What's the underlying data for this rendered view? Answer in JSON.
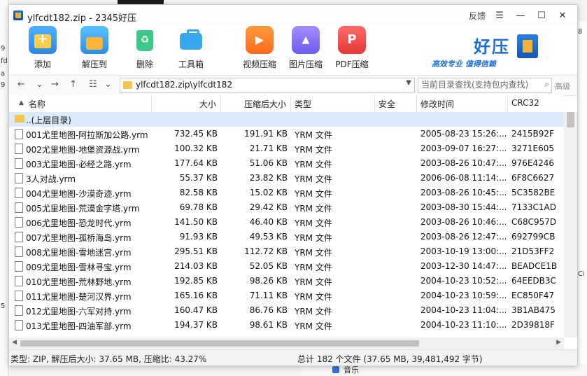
{
  "window": {
    "title": "ylfcdt182.zip - 2345好压",
    "feedback": "反馈",
    "minimize": "—",
    "restore": "☐",
    "close": "✕",
    "menu": "☰"
  },
  "toolbar": {
    "items": [
      {
        "label": "添加",
        "icon": "add-icon"
      },
      {
        "label": "解压到",
        "icon": "extract-icon"
      },
      {
        "label": "删除",
        "icon": "delete-icon"
      },
      {
        "label": "工具箱",
        "icon": "toolbox-icon"
      },
      {
        "label": "视频压缩",
        "icon": "video-compress-icon"
      },
      {
        "label": "图片压缩",
        "icon": "image-compress-icon"
      },
      {
        "label": "PDF压缩",
        "icon": "pdf-compress-icon"
      }
    ],
    "brand_name": "好压",
    "brand_slogan": "高效专业  值得信赖"
  },
  "addressbar": {
    "back": "←",
    "forward": "⌄",
    "up": "↑",
    "view": "☷",
    "view_dd": "⌄",
    "path": "ylfcdt182.zip\\ylfcdt182",
    "dropdown": "▼",
    "search_placeholder": "当前目录查找(支持包内查找)",
    "search_icon": "⌕",
    "advanced": "高级"
  },
  "table": {
    "columns": [
      "名称",
      "大小",
      "压缩后大小",
      "类型",
      "安全",
      "修改时间",
      "CRC32"
    ],
    "sort_indicator": "▲",
    "parent_label": "..(上层目录)",
    "rows": [
      {
        "name": "001尤里地图-阿拉斯加公路.yrm",
        "size": "732.45 KB",
        "packed": "191.91 KB",
        "type": "YRM 文件",
        "safe": "",
        "mtime": "2005-08-23 15:26:...",
        "crc": "2415B92F"
      },
      {
        "name": "002尤里地图-地堡资源战.yrm",
        "size": "100.32 KB",
        "packed": "21.71 KB",
        "type": "YRM 文件",
        "safe": "",
        "mtime": "2003-09-07 16:27:...",
        "crc": "3271E605"
      },
      {
        "name": "003尤里地图-必经之路.yrm",
        "size": "177.64 KB",
        "packed": "51.06 KB",
        "type": "YRM 文件",
        "safe": "",
        "mtime": "2003-08-26 10:47:...",
        "crc": "976E4246"
      },
      {
        "name": "3人对战.yrm",
        "size": "55.37 KB",
        "packed": "23.82 KB",
        "type": "YRM 文件",
        "safe": "",
        "mtime": "2006-06-08 11:14:...",
        "crc": "6F8C6627"
      },
      {
        "name": "004尤里地图-沙漠奇迹.yrm",
        "size": "82.58 KB",
        "packed": "15.02 KB",
        "type": "YRM 文件",
        "safe": "",
        "mtime": "2003-08-26 10:45:...",
        "crc": "5C3582BE"
      },
      {
        "name": "005尤里地图-荒漠金字塔.yrm",
        "size": "69.78 KB",
        "packed": "29.42 KB",
        "type": "YRM 文件",
        "safe": "",
        "mtime": "2003-08-30 15:44:...",
        "crc": "7133C1AD"
      },
      {
        "name": "006尤里地图-恐龙时代.yrm",
        "size": "141.50 KB",
        "packed": "46.40 KB",
        "type": "YRM 文件",
        "safe": "",
        "mtime": "2003-08-26 10:46:...",
        "crc": "C68C957D"
      },
      {
        "name": "007尤里地图-孤桥海岛.yrm",
        "size": "91.93 KB",
        "packed": "49.53 KB",
        "type": "YRM 文件",
        "safe": "",
        "mtime": "2003-08-26 12:47:...",
        "crc": "692799CB"
      },
      {
        "name": "008尤里地图-雪地迷宫.yrm",
        "size": "295.51 KB",
        "packed": "112.72 KB",
        "type": "YRM 文件",
        "safe": "",
        "mtime": "2003-10-19 13:00:...",
        "crc": "21D53FF2"
      },
      {
        "name": "009尤里地图-雪林寻宝.yrm",
        "size": "214.03 KB",
        "packed": "52.05 KB",
        "type": "YRM 文件",
        "safe": "",
        "mtime": "2003-12-30 14:47:...",
        "crc": "BEADCE1B"
      },
      {
        "name": "010尤里地图-荒林野地.yrm",
        "size": "192.85 KB",
        "packed": "98.26 KB",
        "type": "YRM 文件",
        "safe": "",
        "mtime": "2004-10-23 10:52:...",
        "crc": "64EEDB3C"
      },
      {
        "name": "011尤里地图-楚河汉界.yrm",
        "size": "165.16 KB",
        "packed": "71.11 KB",
        "type": "YRM 文件",
        "safe": "",
        "mtime": "2004-10-23 10:59:...",
        "crc": "EC850F47"
      },
      {
        "name": "012尤里地图-六军对持.yrm",
        "size": "160.47 KB",
        "packed": "86.76 KB",
        "type": "YRM 文件",
        "safe": "",
        "mtime": "2004-10-23 11:04:...",
        "crc": "3B1AB475"
      },
      {
        "name": "013尤里地图-四油军部.yrm",
        "size": "194.37 KB",
        "packed": "98.61 KB",
        "type": "YRM 文件",
        "safe": "",
        "mtime": "2004-10-23 11:10:...",
        "crc": "2D39818F"
      }
    ]
  },
  "status": {
    "left": "类型: ZIP, 解压后大小: 37.65 MB, 压缩比: 43.27%",
    "right": "总计 182 个文件 (37.65 MB, 39,481,492 字节)"
  },
  "background": {
    "taskbar_item": "音乐",
    "left_glyphs": [
      "9",
      "fd",
      "a",
      "9",
      "5"
    ],
    "right_glyphs": [
      "8",
      "Ci"
    ]
  }
}
